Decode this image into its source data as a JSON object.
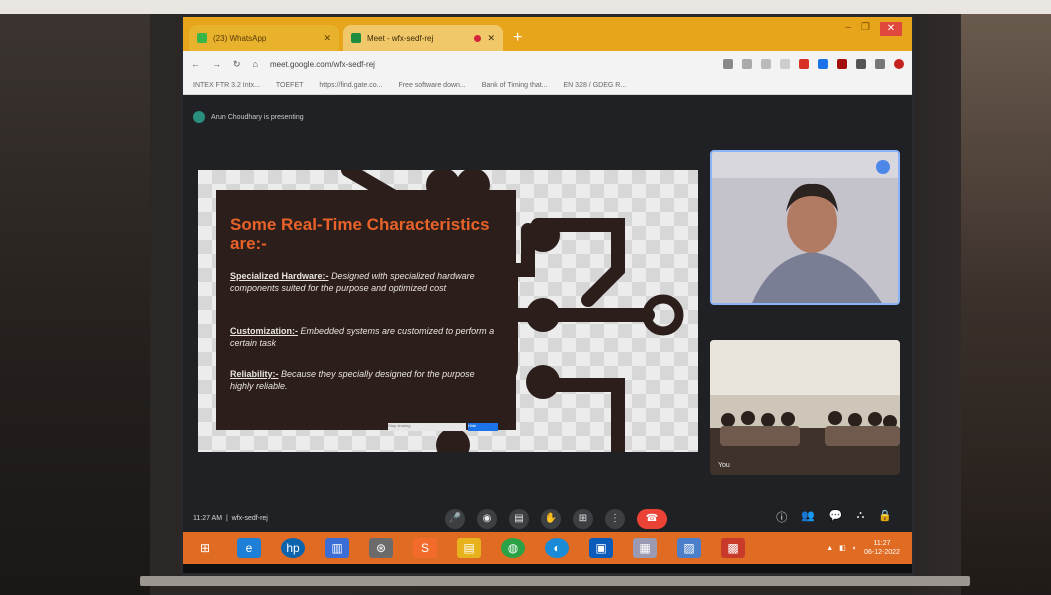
{
  "browser": {
    "tabs": [
      {
        "label": "(23) WhatsApp",
        "active": false
      },
      {
        "label": "Meet - wfx-sedf-rej",
        "active": true
      }
    ],
    "new_tab": "+",
    "url": "meet.google.com/wfx-sedf-rej",
    "bookmarks": [
      "INTEX FTR 3.2 Intx...",
      "TOEFET",
      "https://find.gate.co...",
      "Free software down...",
      "Bank of Timing that...",
      "EN 328 / GDEG R..."
    ],
    "win_controls": {
      "min": "–",
      "max": "❐",
      "close": "✕"
    }
  },
  "meet": {
    "presenter_label": "Arun Choudhary is presenting",
    "slide": {
      "title": "Some Real-Time Characteristics are:-",
      "points": [
        {
          "head": "Specialized Hardware:-",
          "body": "Designed with specialized hardware components suited for the purpose and optimized cost"
        },
        {
          "head": "Customization:-",
          "body": "Embedded systems are customized to perform a certain task"
        },
        {
          "head": "Reliability:-",
          "body": "Because they specially designed for the purpose highly reliable."
        }
      ],
      "share_bar": {
        "left": "Stop sharing",
        "right": "Hide"
      }
    },
    "tile2_name": "You",
    "time": "11:27 AM",
    "meeting_code": "wfx-sedf-rej"
  },
  "controls": {
    "center": [
      {
        "name": "mic",
        "glyph": "🎤"
      },
      {
        "name": "camera",
        "glyph": "◉"
      },
      {
        "name": "captions",
        "glyph": "▤"
      },
      {
        "name": "raise-hand",
        "glyph": "✋"
      },
      {
        "name": "present",
        "glyph": "⊞"
      },
      {
        "name": "more",
        "glyph": "⋮"
      },
      {
        "name": "end-call",
        "glyph": "☎"
      }
    ],
    "right": [
      "ⓘ",
      "👥",
      "💬",
      "⛬",
      "🔒"
    ]
  },
  "taskbar": {
    "items": [
      "⊞",
      "e",
      "hp",
      "▥",
      "⊛",
      "S",
      "▤",
      "◍",
      "◐",
      "▣",
      "▦",
      "▨",
      "▩"
    ],
    "tray_time": "11:27",
    "tray_date": "06-12-2022"
  }
}
